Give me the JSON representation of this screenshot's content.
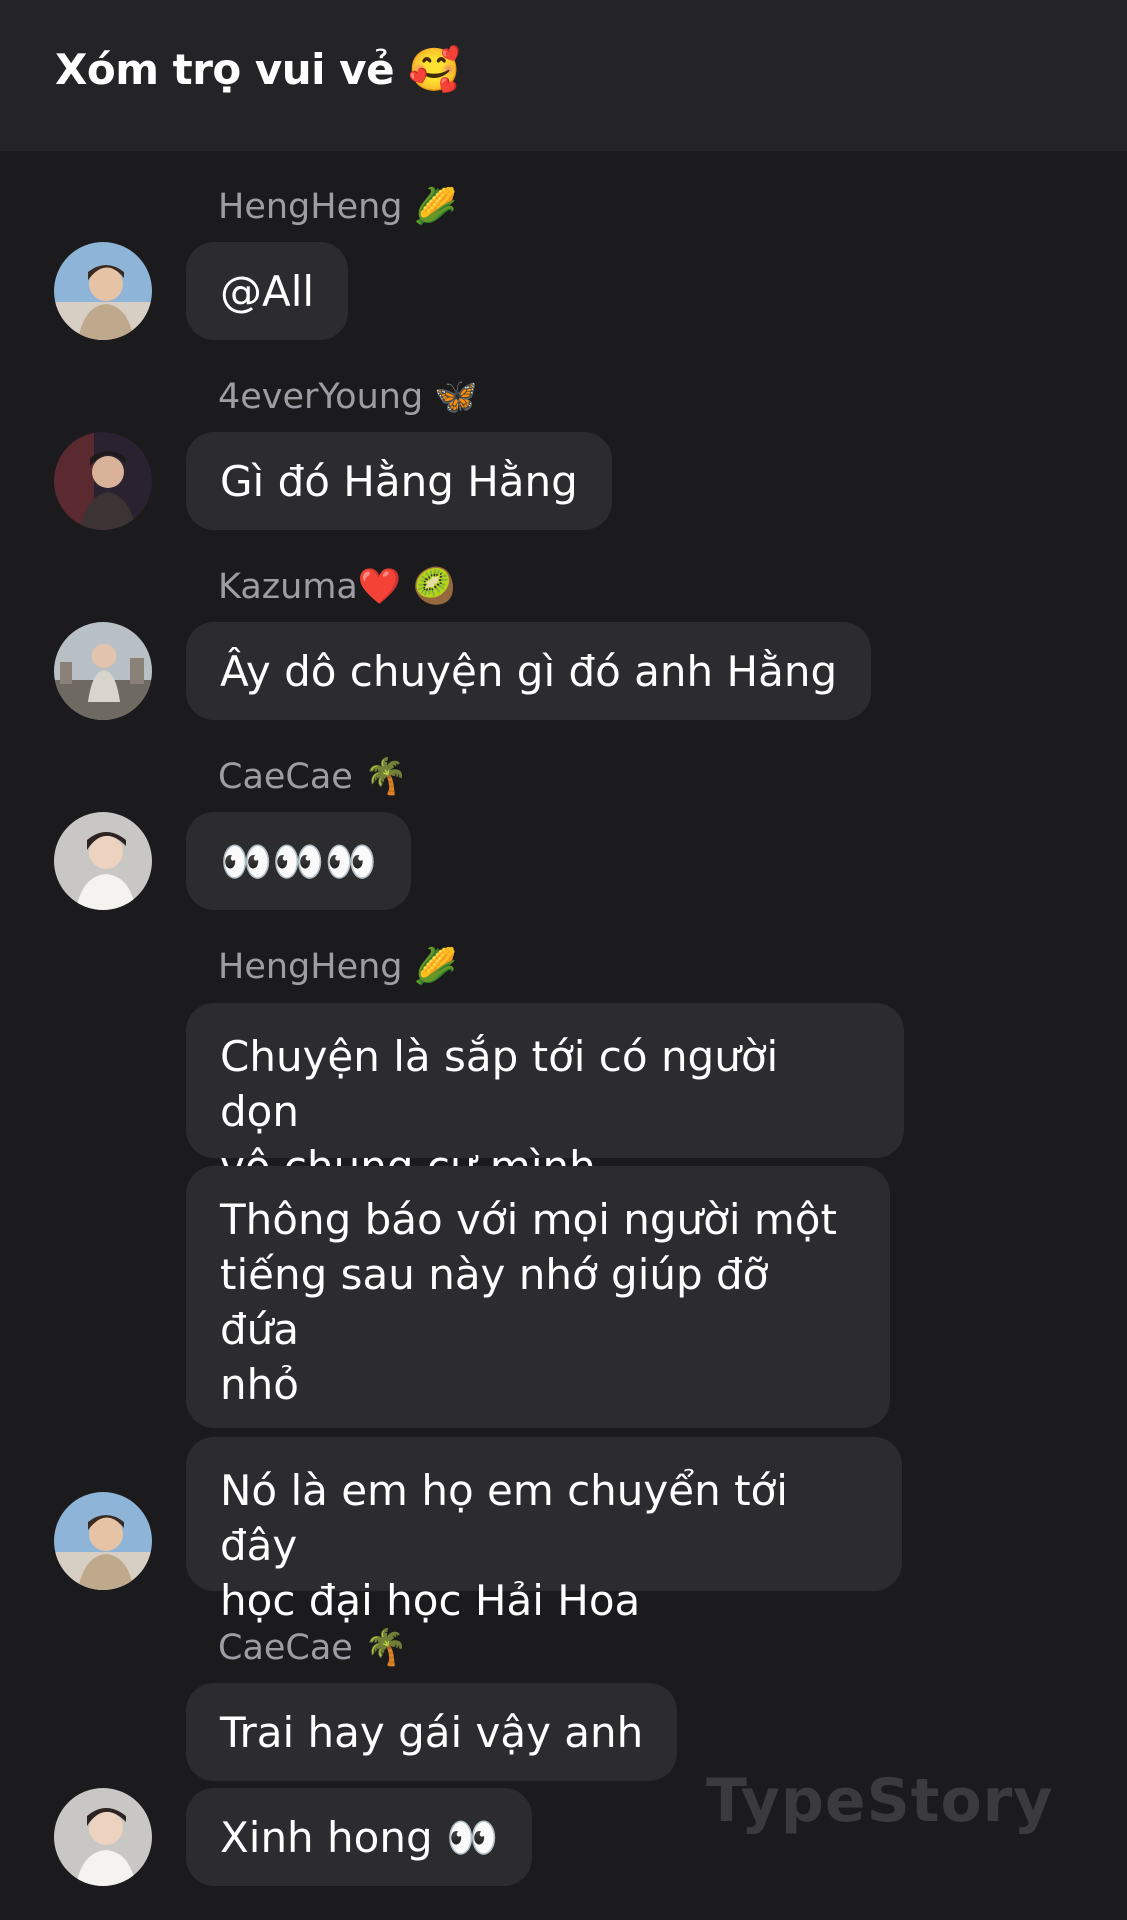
{
  "header": {
    "title": "Xóm trọ vui vẻ 🥰"
  },
  "messages": [
    {
      "sender": "HengHeng 🌽",
      "text": "@All"
    },
    {
      "sender": "4everYoung 🦋",
      "text": "Gì đó Hằng Hằng"
    },
    {
      "sender": "Kazuma❤️ 🥝",
      "text": "Ây dô chuyện gì đó anh Hằng"
    },
    {
      "sender": "CaeCae 🌴",
      "text": "👀👀👀"
    },
    {
      "sender": "HengHeng 🌽",
      "text": "Chuyện là sắp tới có người dọn\nvô chung cư mình"
    },
    {
      "text": "Thông báo với mọi người một\ntiếng sau này nhớ giúp đỡ đứa\nnhỏ"
    },
    {
      "text": "Nó là em họ em chuyển tới đây\nhọc đại học Hải Hoa"
    },
    {
      "sender": "CaeCae 🌴",
      "text": "Trai hay gái vậy anh"
    },
    {
      "text": "Xinh hong 👀"
    }
  ],
  "avatars": [
    {
      "user": "HengHeng",
      "icon": "avatar-photo-icon",
      "bg": "#8eb4d8"
    },
    {
      "user": "4everYoung",
      "icon": "avatar-photo-icon",
      "bg": "#2a2230"
    },
    {
      "user": "Kazuma",
      "icon": "avatar-photo-icon",
      "bg": "#9aa3a8"
    },
    {
      "user": "CaeCae",
      "icon": "avatar-photo-icon",
      "bg": "#c9c7c4"
    },
    {
      "user": "HengHeng",
      "icon": "avatar-photo-icon",
      "bg": "#8eb4d8"
    },
    {
      "user": "CaeCae",
      "icon": "avatar-photo-icon",
      "bg": "#c9c7c4"
    }
  ],
  "watermark": "TypeStory",
  "colors": {
    "background": "#1b1b1d",
    "header": "#242426",
    "bubble": "#2c2c2f",
    "sender_name": "#9d9da3",
    "text": "#ffffff"
  }
}
